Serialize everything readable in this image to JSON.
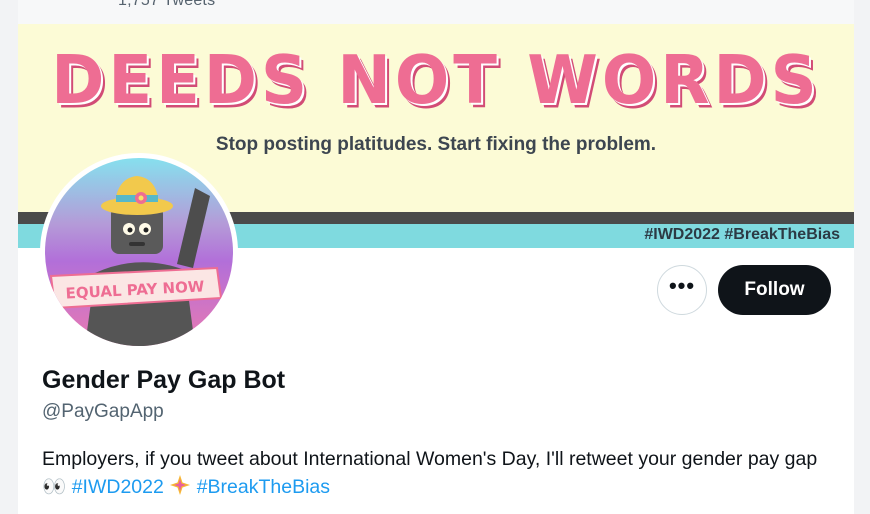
{
  "header": {
    "tweet_count": "1,757 Tweets"
  },
  "banner": {
    "title": "DEEDS NOT WORDS",
    "subtitle": "Stop posting platitudes. Start fixing the problem.",
    "hashtags": "#IWD2022 #BreakTheBias"
  },
  "avatar": {
    "ribbon_text": "EQUAL PAY NOW"
  },
  "actions": {
    "more_label": "•••",
    "follow_label": "Follow"
  },
  "profile": {
    "name": "Gender Pay Gap Bot",
    "handle": "@PayGapApp",
    "bio_text": "Employers, if you tweet about International Women's Day, I'll retweet your gender pay gap 👀 ",
    "hashtag_1": "#IWD2022",
    "hashtag_2": "#BreakTheBias"
  },
  "colors": {
    "banner_pink": "#ee6d93",
    "banner_yellow": "#fcfbd6",
    "banner_teal": "#7fdadf",
    "link_blue": "#1d9bf0",
    "button_dark": "#0f1419"
  }
}
